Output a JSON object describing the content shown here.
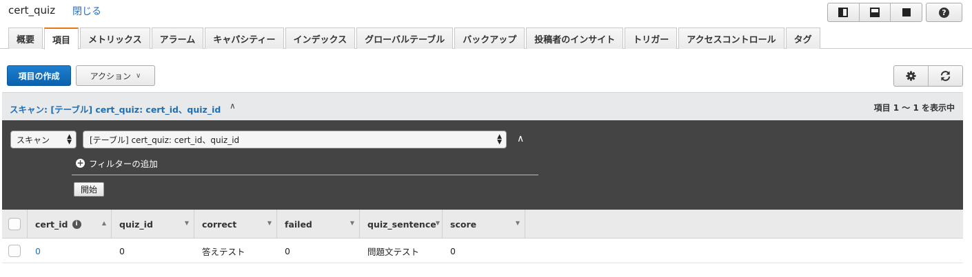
{
  "header": {
    "title": "cert_quiz",
    "close_label": "閉じる",
    "layout_icons": [
      "split-right-panel-icon",
      "split-bottom-panel-icon",
      "full-panel-icon"
    ],
    "help_icon": "help-icon",
    "help_glyph": "?"
  },
  "tabs": [
    {
      "label": "概要",
      "active": false
    },
    {
      "label": "項目",
      "active": true
    },
    {
      "label": "メトリックス",
      "active": false
    },
    {
      "label": "アラーム",
      "active": false
    },
    {
      "label": "キャパシティー",
      "active": false
    },
    {
      "label": "インデックス",
      "active": false
    },
    {
      "label": "グローバルテーブル",
      "active": false
    },
    {
      "label": "バックアップ",
      "active": false
    },
    {
      "label": "投稿者のインサイト",
      "active": false
    },
    {
      "label": "トリガー",
      "active": false
    },
    {
      "label": "アクセスコントロール",
      "active": false
    },
    {
      "label": "タグ",
      "active": false
    }
  ],
  "toolbar": {
    "create_item_label": "項目の作成",
    "actions_label": "アクション",
    "settings_icon": "gear-icon",
    "refresh_icon": "refresh-icon"
  },
  "scan": {
    "title": "スキャン: [テーブル] cert_quiz: cert_id、quiz_id",
    "count_text": "項目 1 〜 1 を表示中",
    "mode_value": "スキャン",
    "table_value": "[テーブル] cert_quiz: cert_id、quiz_id",
    "add_filter_label": "フィルターの追加",
    "start_label": "開始"
  },
  "table": {
    "columns": [
      "cert_id",
      "quiz_id",
      "correct",
      "failed",
      "quiz_sentence",
      "score"
    ],
    "rows": [
      [
        "0",
        "0",
        "答えテスト",
        "0",
        "問題文テスト",
        "0"
      ]
    ]
  },
  "colors": {
    "accent_blue": "#1f6fb6",
    "primary_button": "#0b62ad",
    "active_tab_border": "#e47911",
    "panel_dark": "#444444"
  }
}
